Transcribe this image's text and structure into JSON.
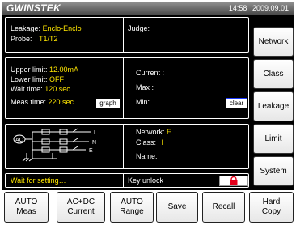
{
  "header": {
    "logo": "GWINSTEK",
    "time": "14:58",
    "date": "2009.09.01"
  },
  "info": {
    "leakage_label": "Leakage:",
    "leakage_value": "Enclo-Enclo",
    "probe_label": "Probe:",
    "probe_value": "T1/T2",
    "judge_label": "Judge:"
  },
  "settings": {
    "upper_label": "Upper limit:",
    "upper_value": "12.00mA",
    "lower_label": "Lower limit:",
    "lower_value": "OFF",
    "wait_label": "Wait time:",
    "wait_value": "120 sec",
    "meas_label": "Meas time:",
    "meas_value": "220 sec",
    "graph_button": "graph",
    "current_label": "Current :",
    "max_label": "Max :",
    "min_label": "Min:",
    "clear_button": "clear"
  },
  "network": {
    "diagram_labels": [
      "AC",
      "L",
      "N",
      "E"
    ],
    "network_label": "Network:",
    "network_value": "E",
    "class_label": "Class:",
    "class_value": "I",
    "name_label": "Name:"
  },
  "status": {
    "message": "Wait for setting…",
    "key_label": "Key unlock"
  },
  "side_buttons": [
    "Network",
    "Class",
    "Leakage",
    "Limit",
    "System"
  ],
  "bottom_buttons": [
    "AUTO\nMeas",
    "AC+DC\nCurrent",
    "AUTO\nRange",
    "Save",
    "Recall",
    "Hard\nCopy"
  ],
  "colors": {
    "accent_text": "#ffe600",
    "screen_bg": "#000000",
    "lock_icon": "#e3001b"
  }
}
